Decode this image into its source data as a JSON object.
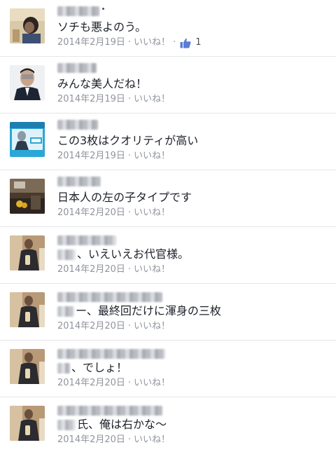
{
  "separator": "·",
  "like_label": "いいね！",
  "comments": [
    {
      "text": "ソチも悪よのう。",
      "date": "2014年2月19日",
      "likes": "1",
      "avatar": "photo-child"
    },
    {
      "text": "みんな美人だね！",
      "date": "2014年2月19日",
      "avatar": "photo-man-suit"
    },
    {
      "text": "この3枚はクオリティが高い",
      "date": "2014年2月19日",
      "avatar": "photo-mint-card"
    },
    {
      "text": "日本人の左の子タイプです",
      "date": "2014年2月20日",
      "avatar": "photo-room"
    },
    {
      "text": "、いえいえお代官様。",
      "date": "2014年2月20日",
      "avatar": "photo-man-glass"
    },
    {
      "text": "ー、最終回だけに渾身の三枚",
      "date": "2014年2月20日",
      "avatar": "photo-man-glass"
    },
    {
      "text": "、でしょ！",
      "date": "2014年2月20日",
      "avatar": "photo-man-glass"
    },
    {
      "text": "氏、俺は右かな〜",
      "date": "2014年2月20日",
      "avatar": "photo-man-glass"
    }
  ]
}
